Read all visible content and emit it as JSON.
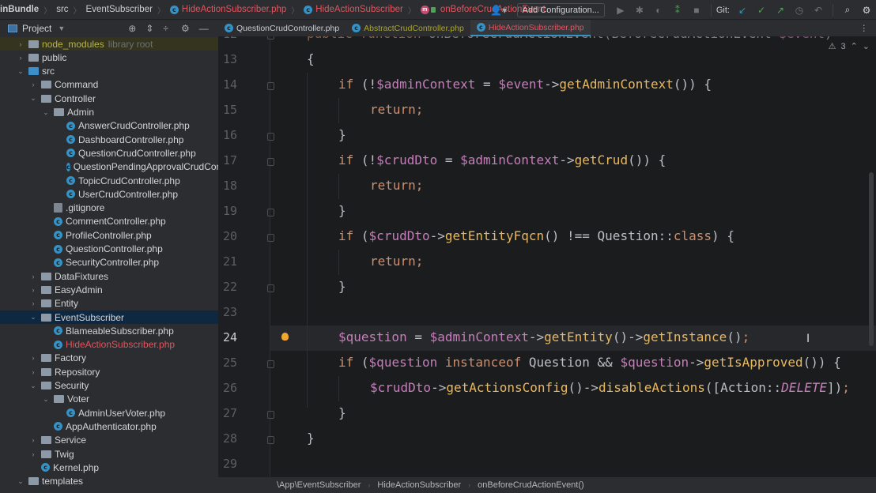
{
  "topbar": {
    "breadcrumbs": [
      "inBundle",
      "src",
      "EventSubscriber",
      "HideActionSubscriber.php",
      "HideActionSubscriber",
      "onBeforeCrudActionEvent"
    ],
    "add_configuration": "Add Configuration...",
    "git_label": "Git:"
  },
  "project_panel": {
    "title": "Project"
  },
  "tabs": [
    {
      "label": "QuestionCrudController.php",
      "color": "#c9ccd1"
    },
    {
      "label": "AbstractCrudController.php",
      "color": "#a8a33a"
    },
    {
      "label": "HideActionSubscriber.php",
      "color": "#e0555f",
      "active": true
    }
  ],
  "tree": [
    {
      "label": "node_modules",
      "suffix": "library root",
      "type": "folder",
      "depth": 0,
      "arrow": "›",
      "highlight": "nm"
    },
    {
      "label": "public",
      "type": "folder",
      "depth": 0,
      "arrow": "›"
    },
    {
      "label": "src",
      "type": "folder-blue",
      "depth": 0,
      "arrow": "⌄"
    },
    {
      "label": "Command",
      "type": "folder",
      "depth": 1,
      "arrow": "›"
    },
    {
      "label": "Controller",
      "type": "folder",
      "depth": 1,
      "arrow": "⌄"
    },
    {
      "label": "Admin",
      "type": "folder",
      "depth": 2,
      "arrow": "⌄"
    },
    {
      "label": "AnswerCrudController.php",
      "type": "class",
      "depth": 3
    },
    {
      "label": "DashboardController.php",
      "type": "class",
      "depth": 3
    },
    {
      "label": "QuestionCrudController.php",
      "type": "class",
      "depth": 3
    },
    {
      "label": "QuestionPendingApprovalCrudController.php",
      "type": "class",
      "depth": 3
    },
    {
      "label": "TopicCrudController.php",
      "type": "class",
      "depth": 3
    },
    {
      "label": "UserCrudController.php",
      "type": "class",
      "depth": 3
    },
    {
      "label": ".gitignore",
      "type": "file",
      "depth": 2
    },
    {
      "label": "CommentController.php",
      "type": "class",
      "depth": 2
    },
    {
      "label": "ProfileController.php",
      "type": "class",
      "depth": 2
    },
    {
      "label": "QuestionController.php",
      "type": "class",
      "depth": 2
    },
    {
      "label": "SecurityController.php",
      "type": "class",
      "depth": 2
    },
    {
      "label": "DataFixtures",
      "type": "folder",
      "depth": 1,
      "arrow": "›"
    },
    {
      "label": "EasyAdmin",
      "type": "folder",
      "depth": 1,
      "arrow": "›"
    },
    {
      "label": "Entity",
      "type": "folder",
      "depth": 1,
      "arrow": "›"
    },
    {
      "label": "EventSubscriber",
      "type": "folder",
      "depth": 1,
      "arrow": "⌄",
      "highlight": "sel"
    },
    {
      "label": "BlameableSubscriber.php",
      "type": "class",
      "depth": 2
    },
    {
      "label": "HideActionSubscriber.php",
      "type": "class",
      "depth": 2,
      "red": true
    },
    {
      "label": "Factory",
      "type": "folder",
      "depth": 1,
      "arrow": "›"
    },
    {
      "label": "Repository",
      "type": "folder",
      "depth": 1,
      "arrow": "›"
    },
    {
      "label": "Security",
      "type": "folder",
      "depth": 1,
      "arrow": "⌄"
    },
    {
      "label": "Voter",
      "type": "folder",
      "depth": 2,
      "arrow": "⌄"
    },
    {
      "label": "AdminUserVoter.php",
      "type": "class",
      "depth": 3
    },
    {
      "label": "AppAuthenticator.php",
      "type": "class",
      "depth": 2
    },
    {
      "label": "Service",
      "type": "folder",
      "depth": 1,
      "arrow": "›"
    },
    {
      "label": "Twig",
      "type": "folder",
      "depth": 1,
      "arrow": "›"
    },
    {
      "label": "Kernel.php",
      "type": "class",
      "depth": 1
    },
    {
      "label": "templates",
      "type": "folder",
      "depth": 0,
      "arrow": "⌄"
    }
  ],
  "editor": {
    "warnings": "3",
    "current_line": 24,
    "lines": [
      {
        "n": 12,
        "indent": 0,
        "tokens": [
          [
            "k",
            "public function "
          ],
          [
            "p",
            "onBeforeCrudActionEvent(BeforeCrudActionEvent "
          ],
          [
            "v",
            "$event"
          ],
          [
            "p",
            ")"
          ]
        ]
      },
      {
        "n": 13,
        "indent": 0,
        "tokens": [
          [
            "p",
            "{"
          ]
        ]
      },
      {
        "n": 14,
        "indent": 1,
        "tokens": [
          [
            "k",
            "if "
          ],
          [
            "p",
            "(!"
          ],
          [
            "v",
            "$adminContext"
          ],
          [
            "p",
            " = "
          ],
          [
            "v",
            "$event"
          ],
          [
            "p",
            "->"
          ],
          [
            "f",
            "getAdminContext"
          ],
          [
            "p",
            "()) {"
          ]
        ]
      },
      {
        "n": 15,
        "indent": 2,
        "tokens": [
          [
            "k",
            "return;"
          ]
        ]
      },
      {
        "n": 16,
        "indent": 1,
        "tokens": [
          [
            "p",
            "}"
          ]
        ]
      },
      {
        "n": 17,
        "indent": 1,
        "tokens": [
          [
            "k",
            "if "
          ],
          [
            "p",
            "(!"
          ],
          [
            "v",
            "$crudDto"
          ],
          [
            "p",
            " = "
          ],
          [
            "v",
            "$adminContext"
          ],
          [
            "p",
            "->"
          ],
          [
            "f",
            "getCrud"
          ],
          [
            "p",
            "()) {"
          ]
        ]
      },
      {
        "n": 18,
        "indent": 2,
        "tokens": [
          [
            "k",
            "return;"
          ]
        ]
      },
      {
        "n": 19,
        "indent": 1,
        "tokens": [
          [
            "p",
            "}"
          ]
        ]
      },
      {
        "n": 20,
        "indent": 1,
        "tokens": [
          [
            "k",
            "if "
          ],
          [
            "p",
            "("
          ],
          [
            "v",
            "$crudDto"
          ],
          [
            "p",
            "->"
          ],
          [
            "f",
            "getEntityFqcn"
          ],
          [
            "p",
            "() !== Question::"
          ],
          [
            "c",
            "class"
          ],
          [
            "p",
            ") {"
          ]
        ]
      },
      {
        "n": 21,
        "indent": 2,
        "tokens": [
          [
            "k",
            "return;"
          ]
        ]
      },
      {
        "n": 22,
        "indent": 1,
        "tokens": [
          [
            "p",
            "}"
          ]
        ]
      },
      {
        "n": 23,
        "indent": 0,
        "tokens": []
      },
      {
        "n": 24,
        "indent": 1,
        "tokens": [
          [
            "v",
            "$question"
          ],
          [
            "p",
            " = "
          ],
          [
            "v",
            "$adminContext"
          ],
          [
            "p",
            "->"
          ],
          [
            "f",
            "getEntity"
          ],
          [
            "p",
            "()->"
          ],
          [
            "f",
            "getInstance"
          ],
          [
            "p",
            "()"
          ],
          [
            "k",
            ";"
          ]
        ]
      },
      {
        "n": 25,
        "indent": 1,
        "tokens": [
          [
            "k",
            "if "
          ],
          [
            "p",
            "("
          ],
          [
            "v",
            "$question"
          ],
          [
            "k",
            " instanceof "
          ],
          [
            "p",
            "Question && "
          ],
          [
            "v",
            "$question"
          ],
          [
            "p",
            "->"
          ],
          [
            "f",
            "getIsApproved"
          ],
          [
            "p",
            "()) {"
          ]
        ]
      },
      {
        "n": 26,
        "indent": 2,
        "tokens": [
          [
            "v",
            "$crudDto"
          ],
          [
            "p",
            "->"
          ],
          [
            "f",
            "getActionsConfig"
          ],
          [
            "p",
            "()->"
          ],
          [
            "f",
            "disableActions"
          ],
          [
            "p",
            "([Action::"
          ],
          [
            "it",
            "DELETE"
          ],
          [
            "p",
            "])"
          ],
          [
            "k",
            ";"
          ]
        ]
      },
      {
        "n": 27,
        "indent": 1,
        "tokens": [
          [
            "p",
            "}"
          ]
        ]
      },
      {
        "n": 28,
        "indent": 0,
        "tokens": [
          [
            "p",
            "}"
          ]
        ]
      },
      {
        "n": 29,
        "indent": 0,
        "tokens": []
      }
    ]
  },
  "statusbar": [
    "\\App\\EventSubscriber",
    "HideActionSubscriber",
    "onBeforeCrudActionEvent()"
  ]
}
